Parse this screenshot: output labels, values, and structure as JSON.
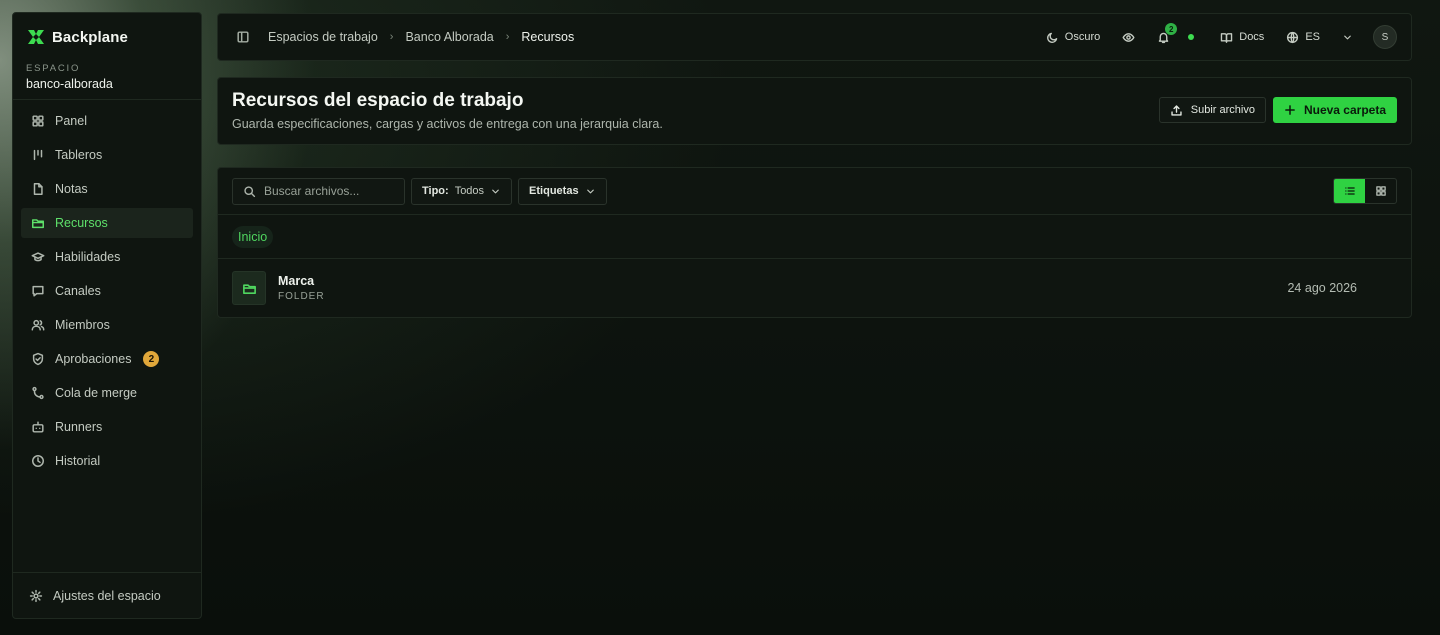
{
  "app": {
    "name": "Backplane"
  },
  "workspace": {
    "label": "ESPACIO",
    "name": "banco-alborada"
  },
  "sidebar": {
    "items": [
      {
        "label": "Panel",
        "icon": "grid-icon"
      },
      {
        "label": "Tableros",
        "icon": "board-icon"
      },
      {
        "label": "Notas",
        "icon": "file-icon"
      },
      {
        "label": "Recursos",
        "icon": "folder-icon",
        "active": true
      },
      {
        "label": "Habilidades",
        "icon": "graduation-cap-icon"
      },
      {
        "label": "Canales",
        "icon": "message-icon"
      },
      {
        "label": "Miembros",
        "icon": "users-icon"
      },
      {
        "label": "Aprobaciones",
        "icon": "shield-check-icon",
        "badge": "2"
      },
      {
        "label": "Cola de merge",
        "icon": "git-merge-icon"
      },
      {
        "label": "Runners",
        "icon": "bot-icon"
      },
      {
        "label": "Historial",
        "icon": "clock-icon"
      }
    ],
    "footer": {
      "label": "Ajustes del espacio",
      "icon": "gear-icon"
    }
  },
  "breadcrumb": {
    "items": [
      "Espacios de trabajo",
      "Banco Alborada"
    ],
    "current": "Recursos",
    "separator": "›"
  },
  "topbar": {
    "theme_label": "Oscuro",
    "notifications_count": "2",
    "docs_label": "Docs",
    "language": "ES",
    "avatar_initial": "S"
  },
  "header": {
    "title": "Recursos del espacio de trabajo",
    "subtitle": "Guarda especificaciones, cargas y activos de entrega con una jerarquia clara.",
    "upload_label": "Subir archivo",
    "new_folder_label": "Nueva carpeta"
  },
  "files": {
    "search_placeholder": "Buscar archivos...",
    "type_filter_label": "Tipo:",
    "type_filter_value": "Todos",
    "tags_filter_label": "Etiquetas",
    "view_mode": "list",
    "path_root": "Inicio",
    "items": [
      {
        "name": "Marca",
        "type": "FOLDER",
        "date": "24 ago 2026"
      }
    ]
  },
  "colors": {
    "accent": "#2fd242",
    "accent_text": "#4fd65f",
    "badge_amber": "#e0a73a",
    "surface": "#0f1510",
    "border": "#1f2920"
  }
}
